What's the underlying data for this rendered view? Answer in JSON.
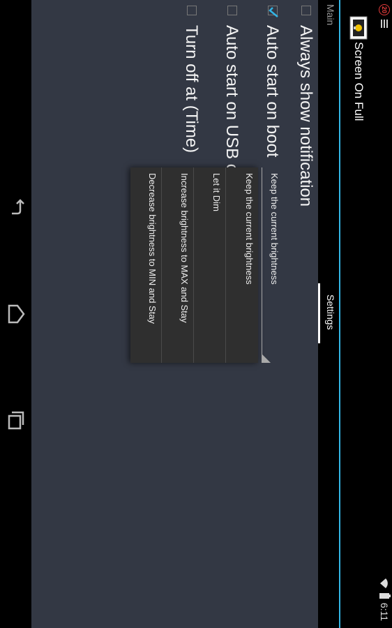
{
  "status_bar": {
    "notification_count": "20",
    "time": "6:11"
  },
  "action_bar": {
    "title": "Screen On Full",
    "accent_color": "#33b5e5"
  },
  "tabs": [
    {
      "label": "Main",
      "selected": false
    },
    {
      "label": "Settings",
      "selected": true
    }
  ],
  "settings": {
    "rows": [
      {
        "label": "Always show notification",
        "checked": false
      },
      {
        "label": "Auto start on boot",
        "checked": true
      },
      {
        "label": "Auto start on USB c",
        "checked": false
      },
      {
        "label": "Turn off at (Time)",
        "checked": false
      }
    ],
    "spinner": {
      "value": "Keep the current brightness"
    },
    "dropdown_options": [
      "Keep the current brightness",
      "Let it Dim",
      "Increase brightness to MAX and Stay",
      "Decrease brightness to MIN and Stay"
    ]
  },
  "nav_bar": {
    "buttons": [
      "back-icon",
      "home-icon",
      "recent-apps-icon"
    ]
  }
}
